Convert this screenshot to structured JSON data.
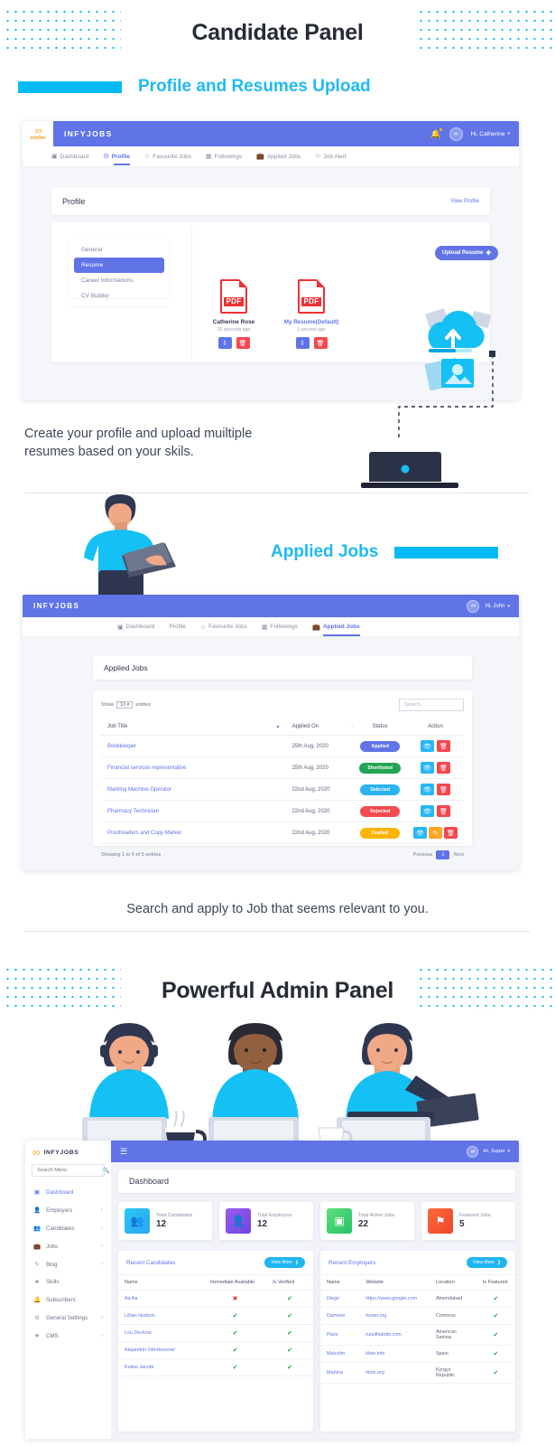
{
  "sections": {
    "candidate": {
      "title": "Candidate Panel",
      "subtitle": "Profile and Resumes Upload",
      "caption_line1": "Create your profile and upload muiltiple",
      "caption_line2": "resumes based on your skils."
    },
    "applied": {
      "subtitle": "Applied Jobs",
      "caption": "Search and apply to Job that seems relevant to you."
    },
    "admin": {
      "title": "Powerful Admin Panel"
    }
  },
  "colors": {
    "accent_cyan": "#00bbf4",
    "brand_indigo": "#6074e8",
    "heading_dark": "#262b35",
    "pdf_red": "#ed3237"
  },
  "app_profile": {
    "brand": "INFYJOBS",
    "logo_word": "InfyOm",
    "user_label": "Hi, Catherine",
    "bell_icon": "bell-icon",
    "chevron_icon": "chevron-down-icon",
    "nav": [
      {
        "label": "Dashboard",
        "icon": "dashboard-icon",
        "active": false
      },
      {
        "label": "Profile",
        "icon": "user-circle-icon",
        "active": true
      },
      {
        "label": "Favourite Jobs",
        "icon": "star-icon",
        "active": false
      },
      {
        "label": "Followings",
        "icon": "building-icon",
        "active": false
      },
      {
        "label": "Applied Jobs",
        "icon": "briefcase-icon",
        "active": false
      },
      {
        "label": "Job Alert",
        "icon": "bell-icon",
        "active": false
      }
    ],
    "page_title": "Profile",
    "view_profile": "View Profile",
    "side_menu": [
      {
        "label": "General",
        "active": false
      },
      {
        "label": "Resume",
        "active": true
      },
      {
        "label": "Career Informations",
        "active": false
      },
      {
        "label": "CV Builder",
        "active": false
      }
    ],
    "upload_button": "Upload Resume",
    "upload_icon": "plus-icon",
    "files": [
      {
        "name": "Catherine Rose",
        "time": "20 seconds ago",
        "type_label": "PDF",
        "is_link": false
      },
      {
        "name": "My Resume(Default)",
        "time": "1 second ago",
        "type_label": "PDF",
        "is_link": true
      }
    ],
    "file_actions": [
      {
        "icon": "download-icon",
        "color": "blue"
      },
      {
        "icon": "trash-icon",
        "color": "red"
      }
    ]
  },
  "app_applied": {
    "brand": "INFYJOBS",
    "user_label": "Hi, John",
    "nav": [
      {
        "label": "Dashboard",
        "icon": "dashboard-icon",
        "active": false
      },
      {
        "label": "Profile",
        "icon": "user-circle-icon",
        "active": false
      },
      {
        "label": "Favourite Jobs",
        "icon": "star-icon",
        "active": false
      },
      {
        "label": "Followings",
        "icon": "building-icon",
        "active": false
      },
      {
        "label": "Applied Jobs",
        "icon": "briefcase-icon",
        "active": true
      }
    ],
    "page_title": "Applied Jobs",
    "show_label_pre": "Show",
    "show_value": "10",
    "show_label_post": "entries",
    "search_placeholder": "Search",
    "columns": [
      "Job Title",
      "Applied On",
      "Status",
      "Action"
    ],
    "rows": [
      {
        "title": "Bookkeeper",
        "date": "25th Aug, 2020",
        "status": "Applied",
        "status_color": "#6074e8",
        "actions": [
          {
            "icon": "eye-icon",
            "color": "cyan"
          },
          {
            "icon": "trash-icon",
            "color": "red"
          }
        ]
      },
      {
        "title": "Financial services representative",
        "date": "25th Aug, 2020",
        "status": "Shortlisted",
        "status_color": "#23a455",
        "actions": [
          {
            "icon": "eye-icon",
            "color": "cyan"
          },
          {
            "icon": "trash-icon",
            "color": "red"
          }
        ]
      },
      {
        "title": "Marking Machine Operator",
        "date": "22nd Aug, 2020",
        "status": "Selected",
        "status_color": "#2cb3ef",
        "actions": [
          {
            "icon": "eye-icon",
            "color": "cyan"
          },
          {
            "icon": "trash-icon",
            "color": "red"
          }
        ]
      },
      {
        "title": "Pharmacy Technician",
        "date": "22nd Aug, 2020",
        "status": "Rejected",
        "status_color": "#f24a4f",
        "actions": [
          {
            "icon": "eye-icon",
            "color": "cyan"
          },
          {
            "icon": "trash-icon",
            "color": "red"
          }
        ]
      },
      {
        "title": "Proofreaders and Copy Marker",
        "date": "22nd Aug, 2020",
        "status": "Drafted",
        "status_color": "#ffb302",
        "actions": [
          {
            "icon": "eye-icon",
            "color": "cyan"
          },
          {
            "icon": "edit-icon",
            "color": "orange"
          },
          {
            "icon": "trash-icon",
            "color": "red"
          }
        ]
      }
    ],
    "showing_text": "Showing 1 to 5 of 5 entries",
    "pager": {
      "previous": "Previous",
      "page": "1",
      "next": "Next"
    }
  },
  "app_admin": {
    "brand": "INFYJOBS",
    "hamburger_icon": "hamburger-icon",
    "user_label": "Hi, Super",
    "search_menu_placeholder": "Search Menu",
    "search_icon": "search-icon",
    "menu": [
      {
        "label": "Dashboard",
        "icon": "dashboard-icon",
        "active": true,
        "chevron": false
      },
      {
        "label": "Employers",
        "icon": "user-icon",
        "active": false,
        "chevron": true
      },
      {
        "label": "Candidates",
        "icon": "users-icon",
        "active": false,
        "chevron": true
      },
      {
        "label": "Jobs",
        "icon": "briefcase-icon",
        "active": false,
        "chevron": true
      },
      {
        "label": "Blog",
        "icon": "pen-icon",
        "active": false,
        "chevron": true
      },
      {
        "label": "Skills",
        "icon": "badge-icon",
        "active": false,
        "chevron": false
      },
      {
        "label": "Subscribers",
        "icon": "bell-icon",
        "active": false,
        "chevron": false
      },
      {
        "label": "General Settings",
        "icon": "gear-icon",
        "active": false,
        "chevron": true
      },
      {
        "label": "CMS",
        "icon": "layers-icon",
        "active": false,
        "chevron": true
      }
    ],
    "page_title": "Dashboard",
    "stats": [
      {
        "label": "Total Candidates",
        "value": "12",
        "icon": "group-icon",
        "c1": "#29c6f5",
        "c2": "#2aa7f0"
      },
      {
        "label": "Total Employers",
        "value": "12",
        "icon": "user-badge-icon",
        "c1": "#9b5bf0",
        "c2": "#6f46e0"
      },
      {
        "label": "Total Active Jobs",
        "value": "22",
        "icon": "calendar-icon",
        "c1": "#5fe07a",
        "c2": "#26c168"
      },
      {
        "label": "Featured Jobs",
        "value": "5",
        "icon": "flag-icon",
        "c1": "#fb6b3c",
        "c2": "#f0442a"
      }
    ],
    "recent_candidates": {
      "title": "Recent Candidates",
      "view_more": "View More",
      "columns": [
        "Name",
        "Immediate Available",
        "Is Verified"
      ],
      "rows": [
        {
          "name": "Aa Aa",
          "available": false,
          "verified": true
        },
        {
          "name": "Lillian Hudson",
          "available": true,
          "verified": true
        },
        {
          "name": "Lou Deckow",
          "available": true,
          "verified": true
        },
        {
          "name": "Alejandrin Oberbrunner",
          "available": true,
          "verified": true
        },
        {
          "name": "Kailee Jacobi",
          "available": true,
          "verified": true
        }
      ]
    },
    "recent_employers": {
      "title": "Recent Employers",
      "view_more": "View More",
      "columns": [
        "Name",
        "Website",
        "Location",
        "Is Featured"
      ],
      "rows": [
        {
          "name": "Diego",
          "website": "https://www.google.com",
          "location": "Ahemdabad",
          "featured": true
        },
        {
          "name": "Dameon",
          "website": "turner.org",
          "location": "Comoros",
          "featured": true
        },
        {
          "name": "Paris",
          "website": "runolfsdottir.com",
          "location": "American Samoa",
          "featured": true
        },
        {
          "name": "Malcolm",
          "website": "klein.info",
          "location": "Spain",
          "featured": true
        },
        {
          "name": "Martina",
          "website": "hintz.org",
          "location": "Kyrgyz Republic",
          "featured": true
        }
      ]
    }
  }
}
